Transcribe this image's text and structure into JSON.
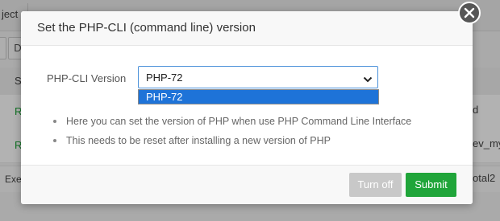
{
  "background": {
    "tab_label": "ject",
    "button_label": "D",
    "table_header_first": "S",
    "rows": [
      {
        "first": "R",
        "last": "d"
      },
      {
        "first": "R",
        "last": "ev_my"
      }
    ],
    "footer_left": "Exe",
    "footer_right": "otal2"
  },
  "modal": {
    "title": "Set the PHP-CLI (command line) version",
    "close_icon": "close-icon",
    "form": {
      "label": "PHP-CLI Version",
      "selected_value": "PHP-72",
      "options": [
        "PHP-72"
      ]
    },
    "tips": [
      "Here you can set the version of PHP when use PHP Command Line Interface",
      "This needs to be reset after installing a new version of PHP"
    ],
    "buttons": {
      "turn_off": "Turn off",
      "submit": "Submit"
    }
  },
  "colors": {
    "accent_green": "#20a53a",
    "selection_blue": "#1e73d8",
    "disabled_gray": "#c8c8c8"
  }
}
